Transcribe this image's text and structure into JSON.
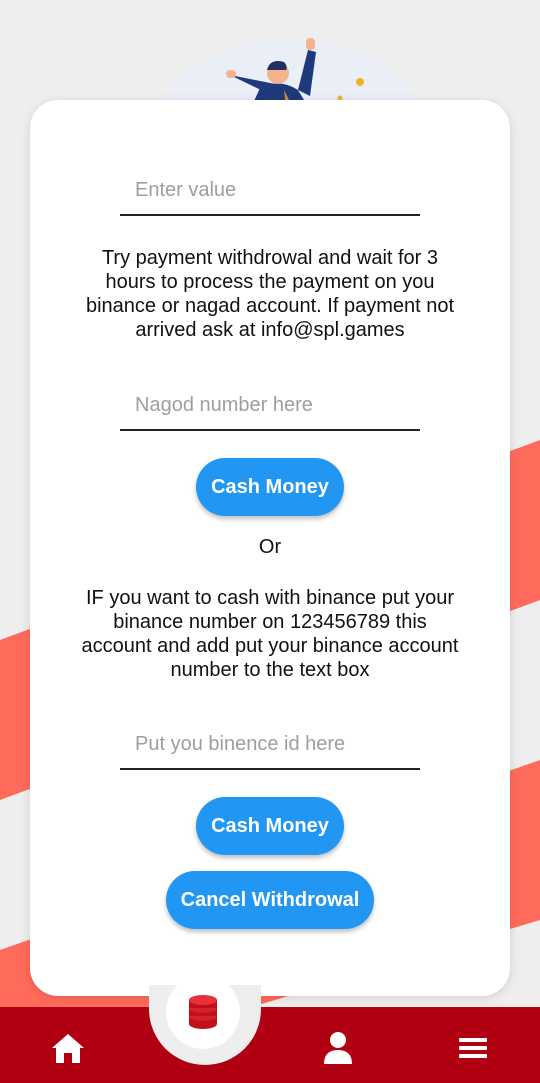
{
  "form": {
    "value_placeholder": "Enter value",
    "instructions": "Try payment withdrowal and wait for 3 hours to process the payment on you binance or nagad account. If payment not arrived ask at info@spl.games",
    "nagad_placeholder": "Nagod number here",
    "cash_button_label": "Cash Money",
    "or_label": "Or",
    "binance_instructions": "IF you want to cash with binance put your binance number on 123456789 this account and add put your binance account number to the text box",
    "binance_placeholder": "Put you binence id here",
    "cash_button_2_label": "Cash Money",
    "cancel_button_label": "Cancel Withdrowal"
  },
  "nav": {
    "items": [
      {
        "icon": "home-icon"
      },
      {
        "icon": "coins-icon"
      },
      {
        "icon": "user-icon"
      },
      {
        "icon": "menu-icon"
      }
    ]
  },
  "colors": {
    "accent": "#2196f3",
    "nav_bar": "#b00012",
    "stripe": "#ff6b5b"
  }
}
